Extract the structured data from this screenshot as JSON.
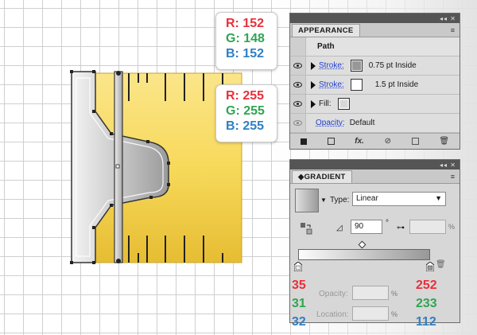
{
  "callout_stroke": {
    "r": "R: 152",
    "g": "G: 148",
    "b": "B: 152"
  },
  "callout_white": {
    "r": "R: 255",
    "g": "G: 255",
    "b": "B: 255"
  },
  "appearance": {
    "tab": "APPEARANCE",
    "menu": "≡",
    "controls": "◂◂ ✕",
    "header": "Path",
    "rows": [
      {
        "label": "Stroke:",
        "value": "0.75 pt Inside"
      },
      {
        "label": "Stroke:",
        "value": "1.5 pt Inside"
      },
      {
        "label": "Fill:",
        "value": ""
      },
      {
        "label": "Opacity:",
        "value": "Default"
      }
    ]
  },
  "gradient": {
    "tab": "GRADIENT",
    "menu": "≡",
    "controls": "◂◂ ✕",
    "type_label": "Type:",
    "type_value": "Linear",
    "angle": "90",
    "degree": "°",
    "percent": "%",
    "opacity_label": "Opacity:",
    "location_label": "Location:",
    "left_stop": {
      "r": "35",
      "g": "31",
      "b": "32"
    },
    "right_stop": {
      "r": "252",
      "g": "233",
      "b": "112"
    }
  },
  "colors": {
    "red": "#e8303a",
    "green": "#2fa552",
    "blue": "#2f7fc4",
    "tape_yellow": "#f7d95a",
    "link": "#1f3fcf"
  }
}
